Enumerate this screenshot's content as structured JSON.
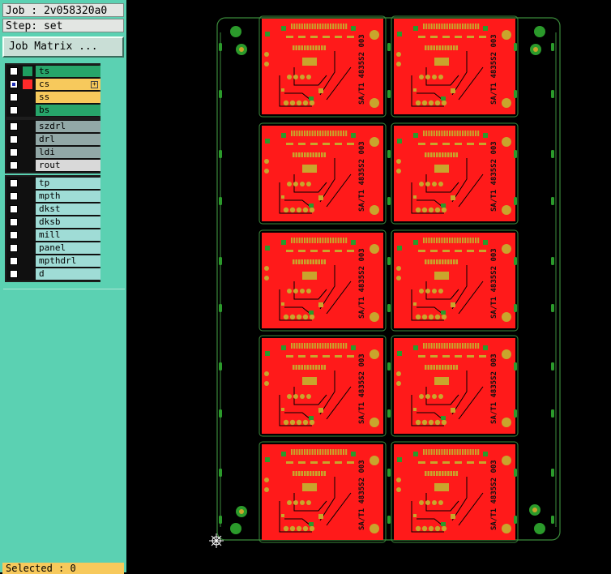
{
  "header": {
    "job": "Job : 2v058320a0",
    "step": "Step: set"
  },
  "job_matrix_button": "Job Matrix ...",
  "layers": [
    {
      "name": "ts",
      "color": "#1e9c60",
      "bg": "#27a56a",
      "checked": false
    },
    {
      "name": "cs",
      "color": "#ff2a2a",
      "bg": "#f7c95c",
      "checked": true,
      "active": true
    },
    {
      "name": "ss",
      "color": "#101010",
      "bg": "#f7c95c",
      "checked": false
    },
    {
      "name": "bs",
      "color": "#101010",
      "bg": "#27a56a",
      "checked": false
    },
    {
      "name": "szdrl",
      "color": "#101010",
      "bg": "#92a8a7",
      "checked": false
    },
    {
      "name": "drl",
      "color": "#101010",
      "bg": "#92a8a7",
      "checked": false
    },
    {
      "name": "ldi",
      "color": "#101010",
      "bg": "#92a8a7",
      "checked": false
    },
    {
      "name": "rout",
      "color": "#101010",
      "bg": "#d9d9d9",
      "checked": false
    },
    {
      "name": "tp",
      "color": "#101010",
      "bg": "#9fdcd6",
      "checked": false
    },
    {
      "name": "mpth",
      "color": "#101010",
      "bg": "#9fdcd6",
      "checked": false
    },
    {
      "name": "dkst",
      "color": "#101010",
      "bg": "#9fdcd6",
      "checked": false
    },
    {
      "name": "dksb",
      "color": "#101010",
      "bg": "#9fdcd6",
      "checked": false
    },
    {
      "name": "mill",
      "color": "#101010",
      "bg": "#9fdcd6",
      "checked": false
    },
    {
      "name": "panel",
      "color": "#101010",
      "bg": "#9fdcd6",
      "checked": false
    },
    {
      "name": "mpthdrl",
      "color": "#101010",
      "bg": "#9fdcd6",
      "checked": false
    },
    {
      "name": "d",
      "color": "#101010",
      "bg": "#9fdcd6",
      "checked": false
    }
  ],
  "status": {
    "selected": "Selected : 0"
  },
  "board_label": "SA/T1 4835S2 003",
  "colors": {
    "panel_bg": "#5bd1b2",
    "board_red": "#ff1a1a",
    "pad_gold": "#c9a52c",
    "outline_green": "#3b8a3b",
    "fiducial_green": "#2b9a2b"
  },
  "icons": {
    "origin_marker": "crosshair-origin-icon"
  }
}
